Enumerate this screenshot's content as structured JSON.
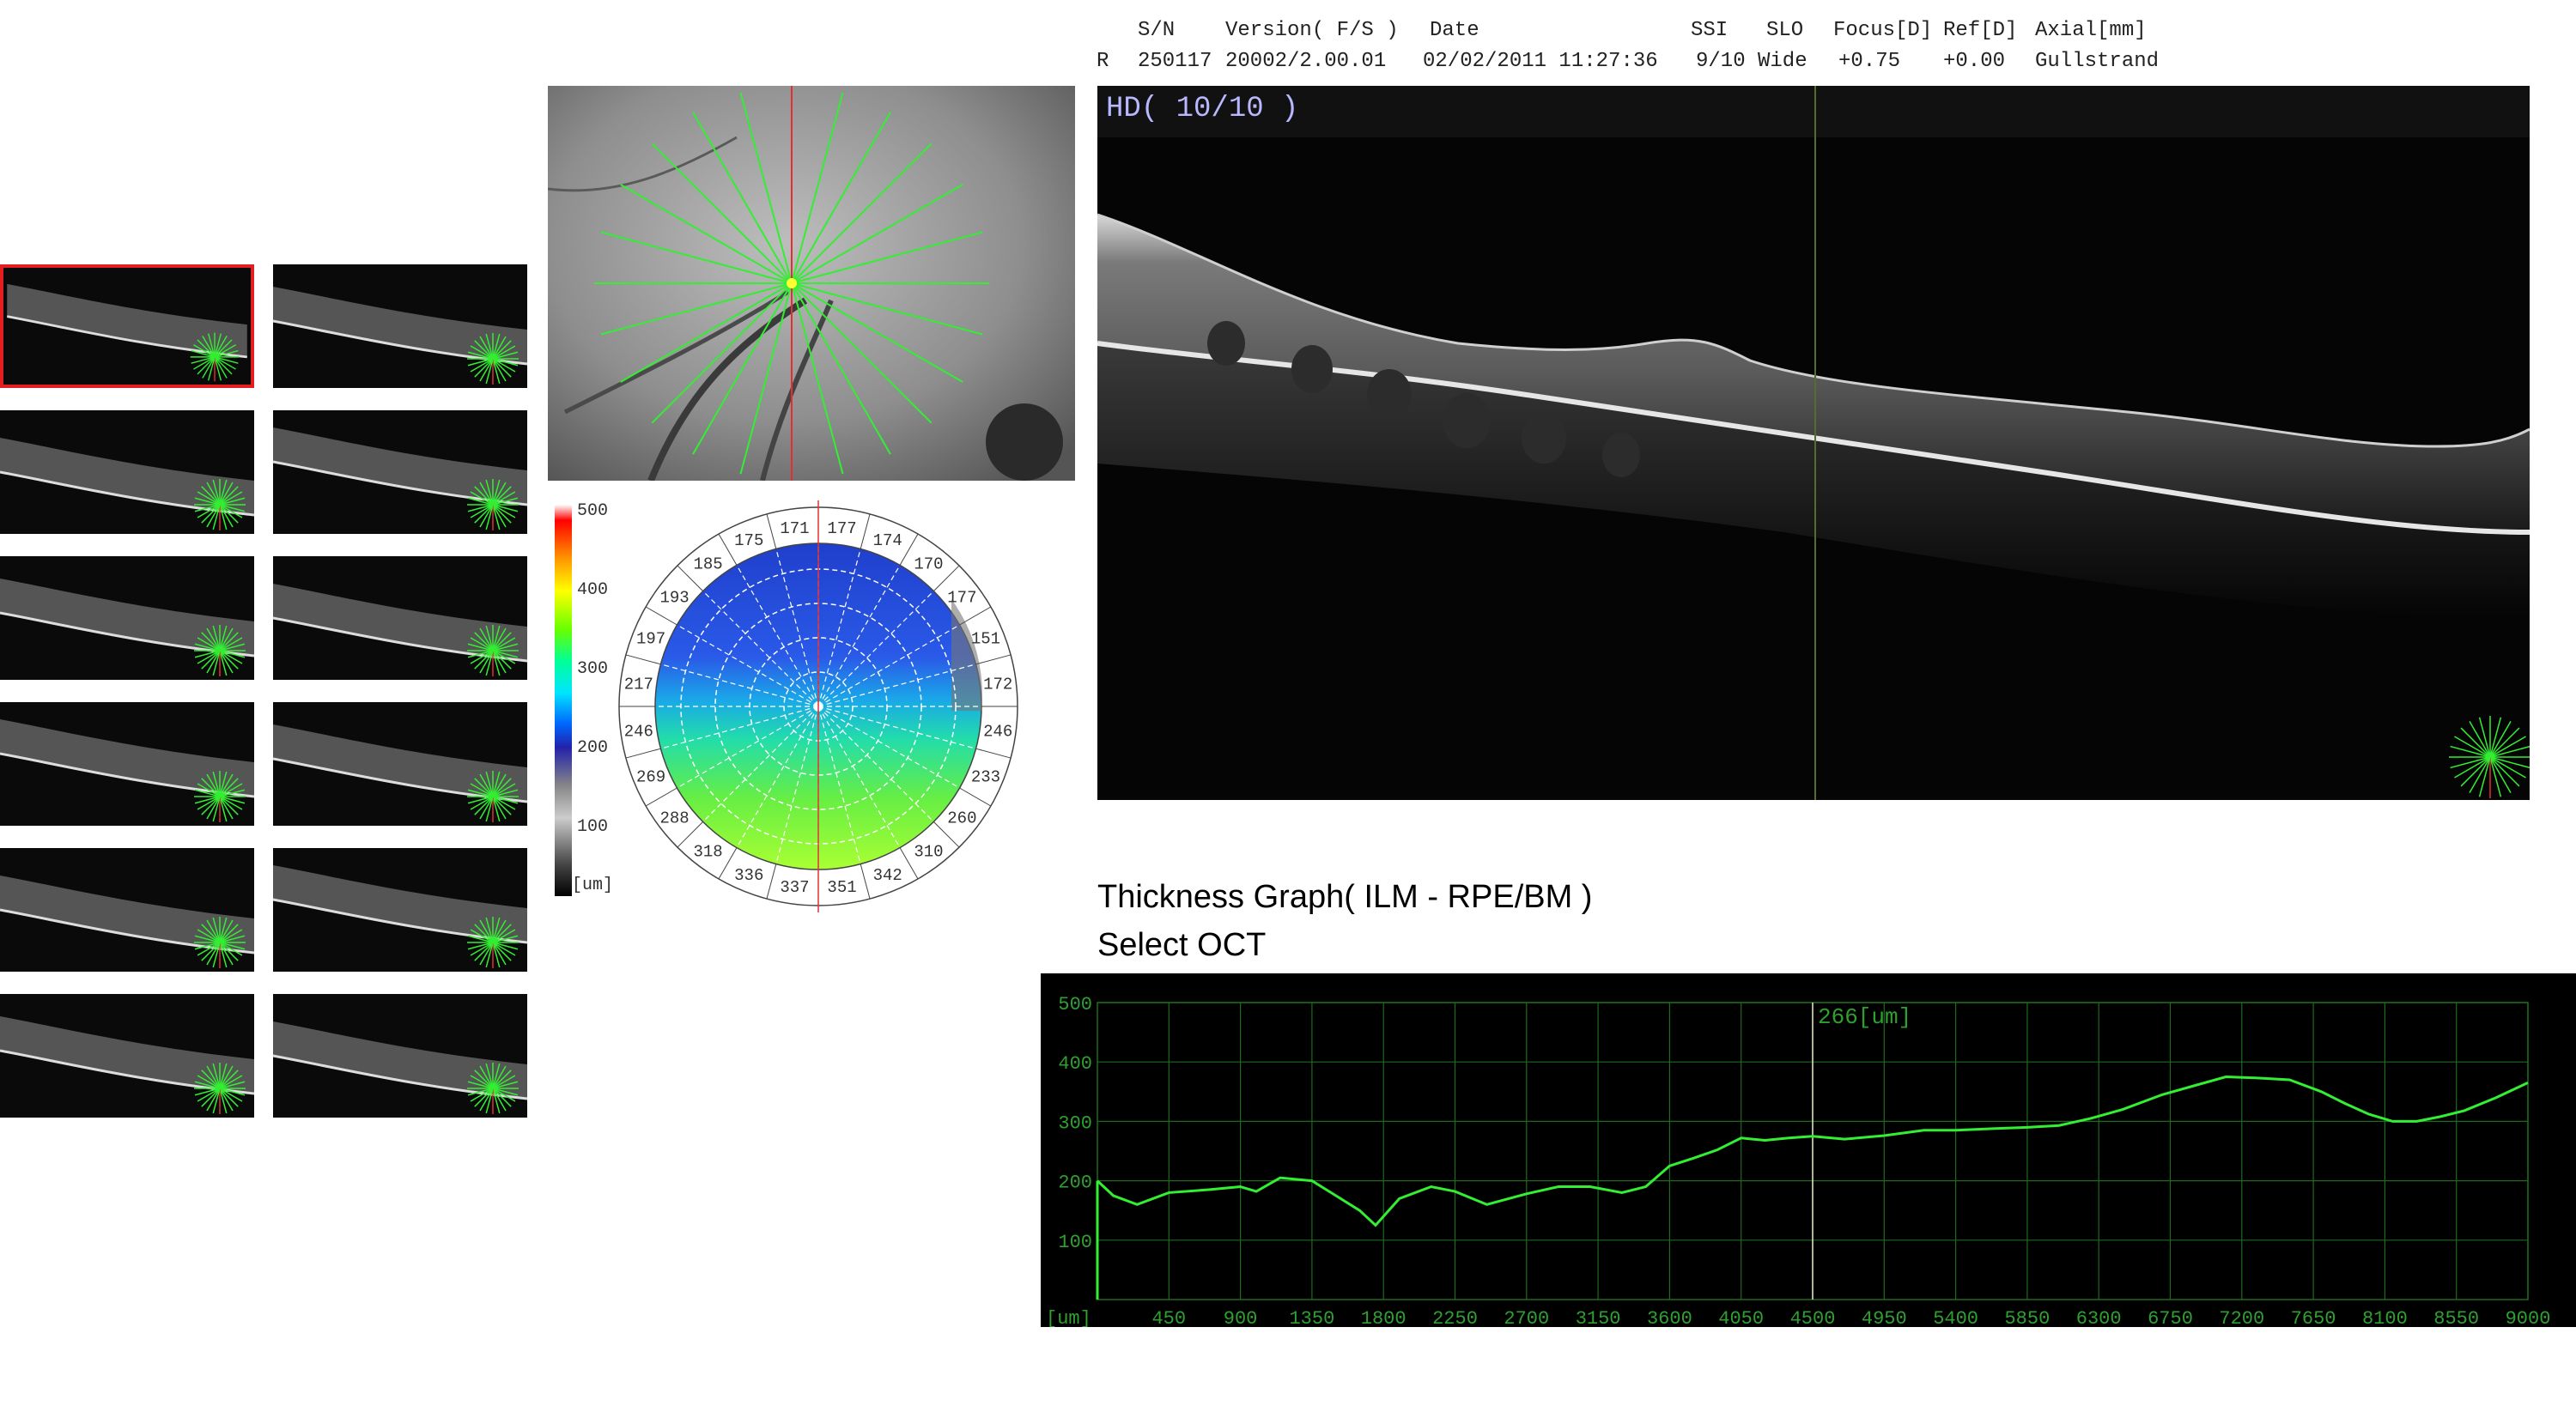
{
  "header": {
    "labels": [
      "S/N",
      "Version( F/S )",
      "Date",
      "SSI",
      "SLO",
      "Focus[D]",
      "Ref[D]",
      "Axial[mm]"
    ],
    "eye": "R",
    "values": [
      "250117",
      "20002/2.00.01",
      "02/02/2011 11:27:36",
      "9/10",
      "Wide",
      "+0.75",
      "+0.00",
      "Gullstrand"
    ]
  },
  "oct_view": {
    "quality_label": "HD( 10/10 )"
  },
  "colorbar": {
    "ticks": [
      "500",
      "400",
      "300",
      "200",
      "100"
    ],
    "unit": "[um]"
  },
  "polar_map": {
    "values": [
      "177",
      "174",
      "170",
      "177",
      "151",
      "172",
      "246",
      "233",
      "260",
      "310",
      "342",
      "351",
      "337",
      "336",
      "318",
      "288",
      "269",
      "246",
      "217",
      "197",
      "193",
      "185",
      "175",
      "171"
    ]
  },
  "thickness": {
    "title": "Thickness Graph( ILM - RPE/BM )",
    "subtitle": "Select OCT"
  },
  "chart_data": {
    "type": "line",
    "title": "Thickness Graph( ILM - RPE/BM )",
    "xlabel": "[um]",
    "ylabel": "",
    "xlim": [
      0,
      9000
    ],
    "ylim": [
      0,
      500
    ],
    "x_ticks": [
      "450",
      "900",
      "1350",
      "1800",
      "2250",
      "2700",
      "3150",
      "3600",
      "4050",
      "4500",
      "4950",
      "5400",
      "5850",
      "6300",
      "6750",
      "7200",
      "7650",
      "8100",
      "8550",
      "9000"
    ],
    "y_ticks": [
      "500",
      "400",
      "300",
      "200",
      "100"
    ],
    "cursor_x": 4500,
    "cursor_label": "266[um]",
    "series": [
      {
        "color": "#33ee33",
        "x": [
          0,
          100,
          250,
          450,
          700,
          900,
          1000,
          1150,
          1350,
          1500,
          1650,
          1750,
          1900,
          2100,
          2250,
          2450,
          2700,
          2900,
          3100,
          3300,
          3450,
          3600,
          3750,
          3900,
          4050,
          4200,
          4350,
          4500,
          4700,
          4950,
          5200,
          5400,
          5650,
          5850,
          6050,
          6250,
          6450,
          6700,
          6900,
          7100,
          7300,
          7500,
          7700,
          7850,
          8000,
          8150,
          8300,
          8450,
          8600,
          8800,
          9000
        ],
        "values": [
          200,
          175,
          160,
          180,
          185,
          190,
          182,
          205,
          200,
          175,
          150,
          125,
          170,
          190,
          182,
          160,
          178,
          190,
          190,
          180,
          190,
          225,
          238,
          252,
          272,
          268,
          272,
          275,
          270,
          276,
          285,
          285,
          288,
          290,
          293,
          305,
          320,
          345,
          360,
          375,
          373,
          370,
          350,
          330,
          312,
          300,
          300,
          308,
          318,
          340,
          365
        ]
      }
    ]
  }
}
